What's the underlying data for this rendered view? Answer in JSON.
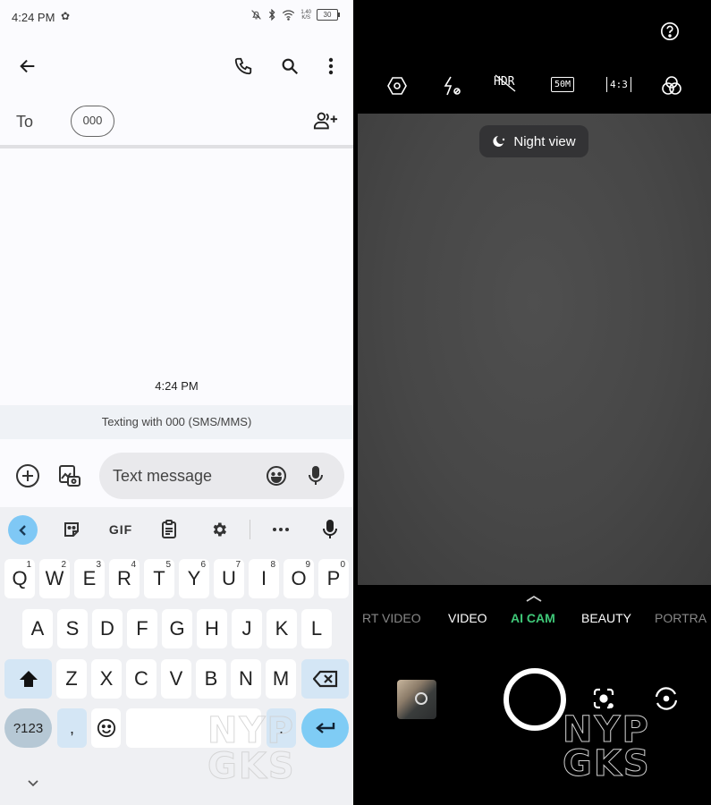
{
  "messages_app": {
    "status_bar": {
      "time": "4:24 PM",
      "network_speed_value": "1.40",
      "network_speed_unit": "K/S",
      "battery": "30"
    },
    "app_bar": {
      "back_icon": "arrow-left-icon",
      "call_icon": "phone-icon",
      "search_icon": "search-icon",
      "more_icon": "more-vert-icon"
    },
    "recipient": {
      "to_label": "To",
      "chip": "000",
      "add_person_icon": "person-add-icon"
    },
    "conversation": {
      "timestamp": "4:24 PM",
      "texting_info": "Texting with 000 (SMS/MMS)"
    },
    "compose": {
      "placeholder": "Text message",
      "add_icon": "plus-circle-icon",
      "gallery_icon": "gallery-camera-icon",
      "emoji_icon": "emoji-icon",
      "mic_icon": "mic-icon"
    },
    "keyboard": {
      "toolbar": {
        "back_icon": "chevron-left-icon",
        "sticker_icon": "sticker-icon",
        "gif_label": "GIF",
        "clipboard_icon": "clipboard-icon",
        "settings_icon": "gear-icon",
        "more_icon": "more-horiz-icon",
        "mic_icon": "mic-icon"
      },
      "row1": [
        {
          "key": "Q",
          "hint": "1"
        },
        {
          "key": "W",
          "hint": "2"
        },
        {
          "key": "E",
          "hint": "3"
        },
        {
          "key": "R",
          "hint": "4"
        },
        {
          "key": "T",
          "hint": "5"
        },
        {
          "key": "Y",
          "hint": "6"
        },
        {
          "key": "U",
          "hint": "7"
        },
        {
          "key": "I",
          "hint": "8"
        },
        {
          "key": "O",
          "hint": "9"
        },
        {
          "key": "P",
          "hint": "0"
        }
      ],
      "row2": [
        "A",
        "S",
        "D",
        "F",
        "G",
        "H",
        "J",
        "K",
        "L"
      ],
      "row3": [
        "Z",
        "X",
        "C",
        "V",
        "B",
        "N",
        "M"
      ],
      "symbols_label": "?123",
      "comma_label": ",",
      "period_label": ".",
      "shift_icon": "shift-icon",
      "backspace_icon": "backspace-icon",
      "enter_icon": "enter-icon",
      "emoji_icon": "emoji-icon",
      "hide_icon": "chevron-down-icon"
    }
  },
  "camera_app": {
    "help_icon": "help-circle-icon",
    "top_controls": [
      {
        "name": "settings-hex-icon",
        "label": ""
      },
      {
        "name": "flash-auto-icon",
        "label": ""
      },
      {
        "name": "hdr-off-icon",
        "label": "HDR"
      },
      {
        "name": "resolution-icon",
        "label": "50M"
      },
      {
        "name": "aspect-ratio-icon",
        "label": "4:3"
      },
      {
        "name": "filters-icon",
        "label": ""
      }
    ],
    "scene_badge": "Night view",
    "modes": [
      "RT VIDEO",
      "VIDEO",
      "AI CAM",
      "BEAUTY",
      "PORTRA"
    ],
    "active_mode": "AI CAM",
    "accent_color": "#3fc878",
    "bottom": {
      "gallery_thumbnail": "last-photo-thumbnail",
      "shutter": "shutter-button",
      "lens_icon": "google-lens-icon",
      "flip_icon": "flip-camera-icon"
    },
    "watermark": [
      "NYP",
      "GKS"
    ]
  }
}
